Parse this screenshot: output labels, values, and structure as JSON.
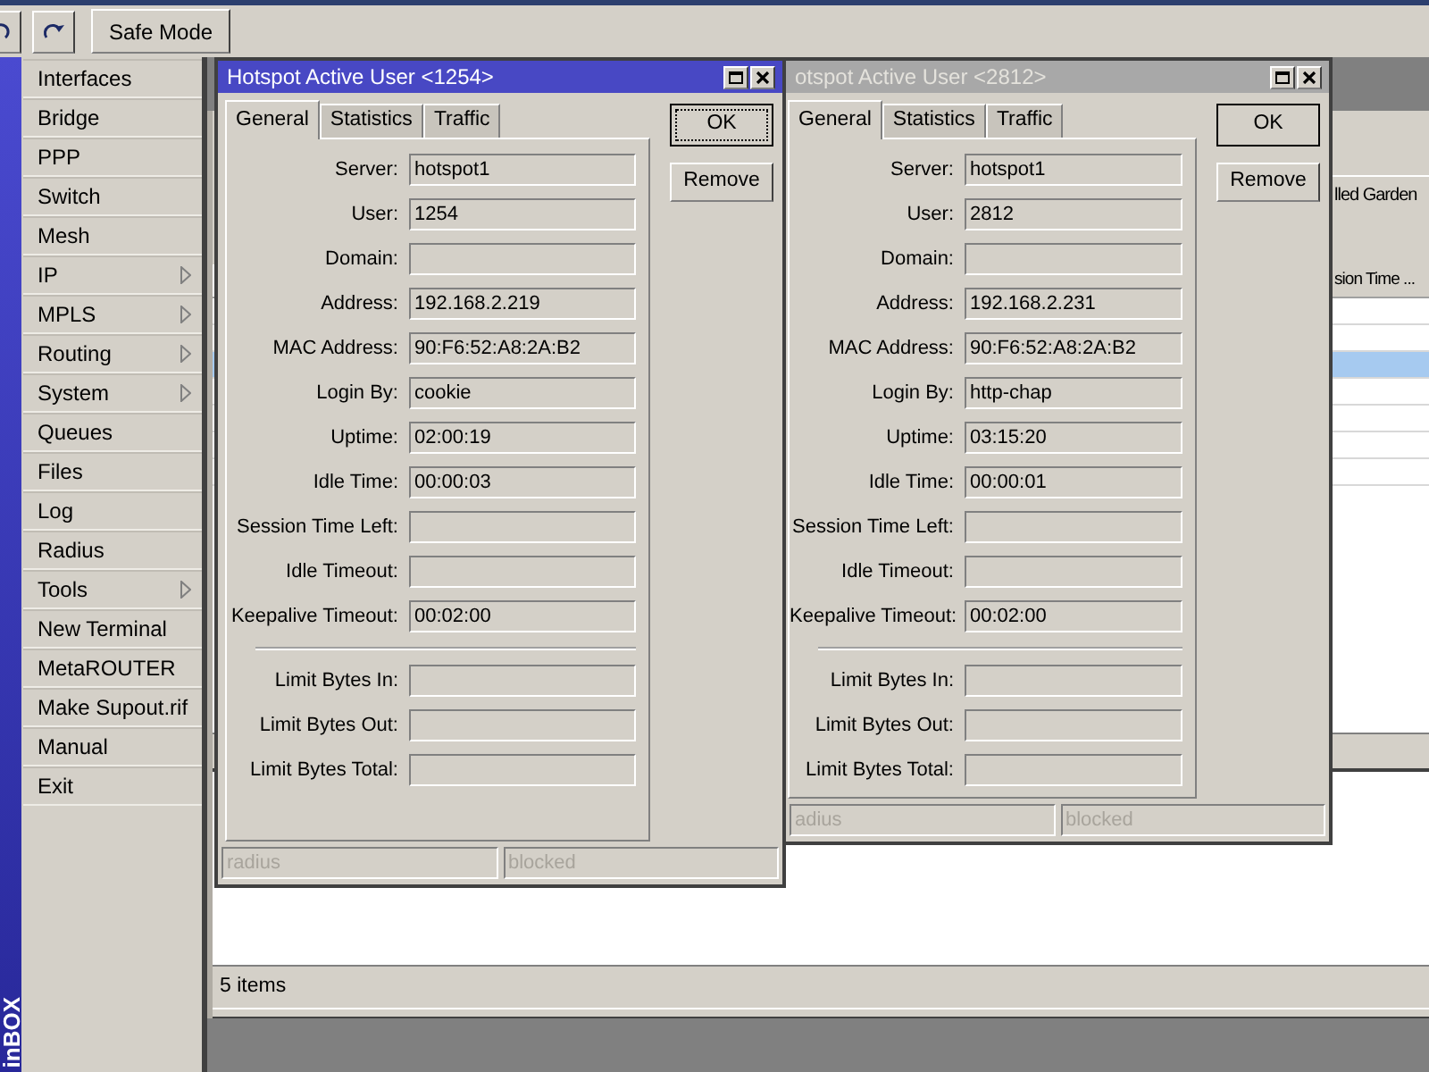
{
  "toolbar": {
    "safe_mode": "Safe Mode"
  },
  "side_label": "inBOX",
  "menu": [
    {
      "label": "Interfaces",
      "submenu": false
    },
    {
      "label": "Bridge",
      "submenu": false
    },
    {
      "label": "PPP",
      "submenu": false
    },
    {
      "label": "Switch",
      "submenu": false
    },
    {
      "label": "Mesh",
      "submenu": false
    },
    {
      "label": "IP",
      "submenu": true
    },
    {
      "label": "MPLS",
      "submenu": true
    },
    {
      "label": "Routing",
      "submenu": true
    },
    {
      "label": "System",
      "submenu": true
    },
    {
      "label": "Queues",
      "submenu": false
    },
    {
      "label": "Files",
      "submenu": false
    },
    {
      "label": "Log",
      "submenu": false
    },
    {
      "label": "Radius",
      "submenu": false
    },
    {
      "label": "Tools",
      "submenu": true
    },
    {
      "label": "New Terminal",
      "submenu": false
    },
    {
      "label": "MetaROUTER",
      "submenu": false
    },
    {
      "label": "Make Supout.rif",
      "submenu": false
    },
    {
      "label": "Manual",
      "submenu": false
    },
    {
      "label": "Exit",
      "submenu": false
    }
  ],
  "main_window": {
    "tab": "lled Garden",
    "column": "sion Time ...",
    "rows": [
      {
        "selected": false
      },
      {
        "selected": false
      },
      {
        "selected": true
      },
      {
        "selected": false
      },
      {
        "selected": false
      },
      {
        "selected": false
      },
      {
        "selected": false
      }
    ],
    "status": "5 items"
  },
  "dialogs": [
    {
      "title": "Hotspot Active User <1254>",
      "active": true,
      "tabs": [
        {
          "label": "General",
          "selected": true
        },
        {
          "label": "Statistics",
          "selected": false
        },
        {
          "label": "Traffic",
          "selected": false
        }
      ],
      "fields": [
        {
          "label": "Server:",
          "value": "hotspot1"
        },
        {
          "label": "User:",
          "value": "1254"
        },
        {
          "label": "Domain:"
        },
        {
          "label": "Address:",
          "value": "192.168.2.219"
        },
        {
          "label": "MAC Address:",
          "value": "90:F6:52:A8:2A:B2"
        },
        {
          "label": "Login By:",
          "value": "cookie"
        },
        {
          "label": "Uptime:",
          "value": "02:00:19"
        },
        {
          "label": "Idle Time:",
          "value": "00:00:03"
        },
        {
          "label": "Session Time Left:"
        },
        {
          "label": "Idle Timeout:"
        },
        {
          "label": "Keepalive Timeout:",
          "value": "00:02:00"
        }
      ],
      "limit_fields": [
        {
          "label": "Limit Bytes In:"
        },
        {
          "label": "Limit Bytes Out:"
        },
        {
          "label": "Limit Bytes Total:"
        }
      ],
      "buttons": [
        {
          "label": "OK",
          "focused": true
        },
        {
          "label": "Remove",
          "focused": false
        }
      ],
      "status": [
        "radius",
        "blocked"
      ]
    },
    {
      "title": "otspot Active User <2812>",
      "active": false,
      "tabs": [
        {
          "label": "General",
          "selected": true
        },
        {
          "label": "Statistics",
          "selected": false
        },
        {
          "label": "Traffic",
          "selected": false
        }
      ],
      "fields": [
        {
          "label": "Server:",
          "value": "hotspot1"
        },
        {
          "label": "User:",
          "value": "2812"
        },
        {
          "label": "Domain:"
        },
        {
          "label": "Address:",
          "value": "192.168.2.231"
        },
        {
          "label": "MAC Address:",
          "value": "90:F6:52:A8:2A:B2"
        },
        {
          "label": "Login By:",
          "value": "http-chap"
        },
        {
          "label": "Uptime:",
          "value": "03:15:20"
        },
        {
          "label": "Idle Time:",
          "value": "00:00:01"
        },
        {
          "label": "Session Time Left:"
        },
        {
          "label": "Idle Timeout:"
        },
        {
          "label": "Keepalive Timeout:",
          "value": "00:02:00"
        }
      ],
      "limit_fields": [
        {
          "label": "Limit Bytes In:"
        },
        {
          "label": "Limit Bytes Out:"
        },
        {
          "label": "Limit Bytes Total:"
        }
      ],
      "buttons": [
        {
          "label": "OK",
          "focused": false
        },
        {
          "label": "Remove",
          "focused": false
        }
      ],
      "status": [
        "adius",
        "blocked"
      ]
    }
  ]
}
